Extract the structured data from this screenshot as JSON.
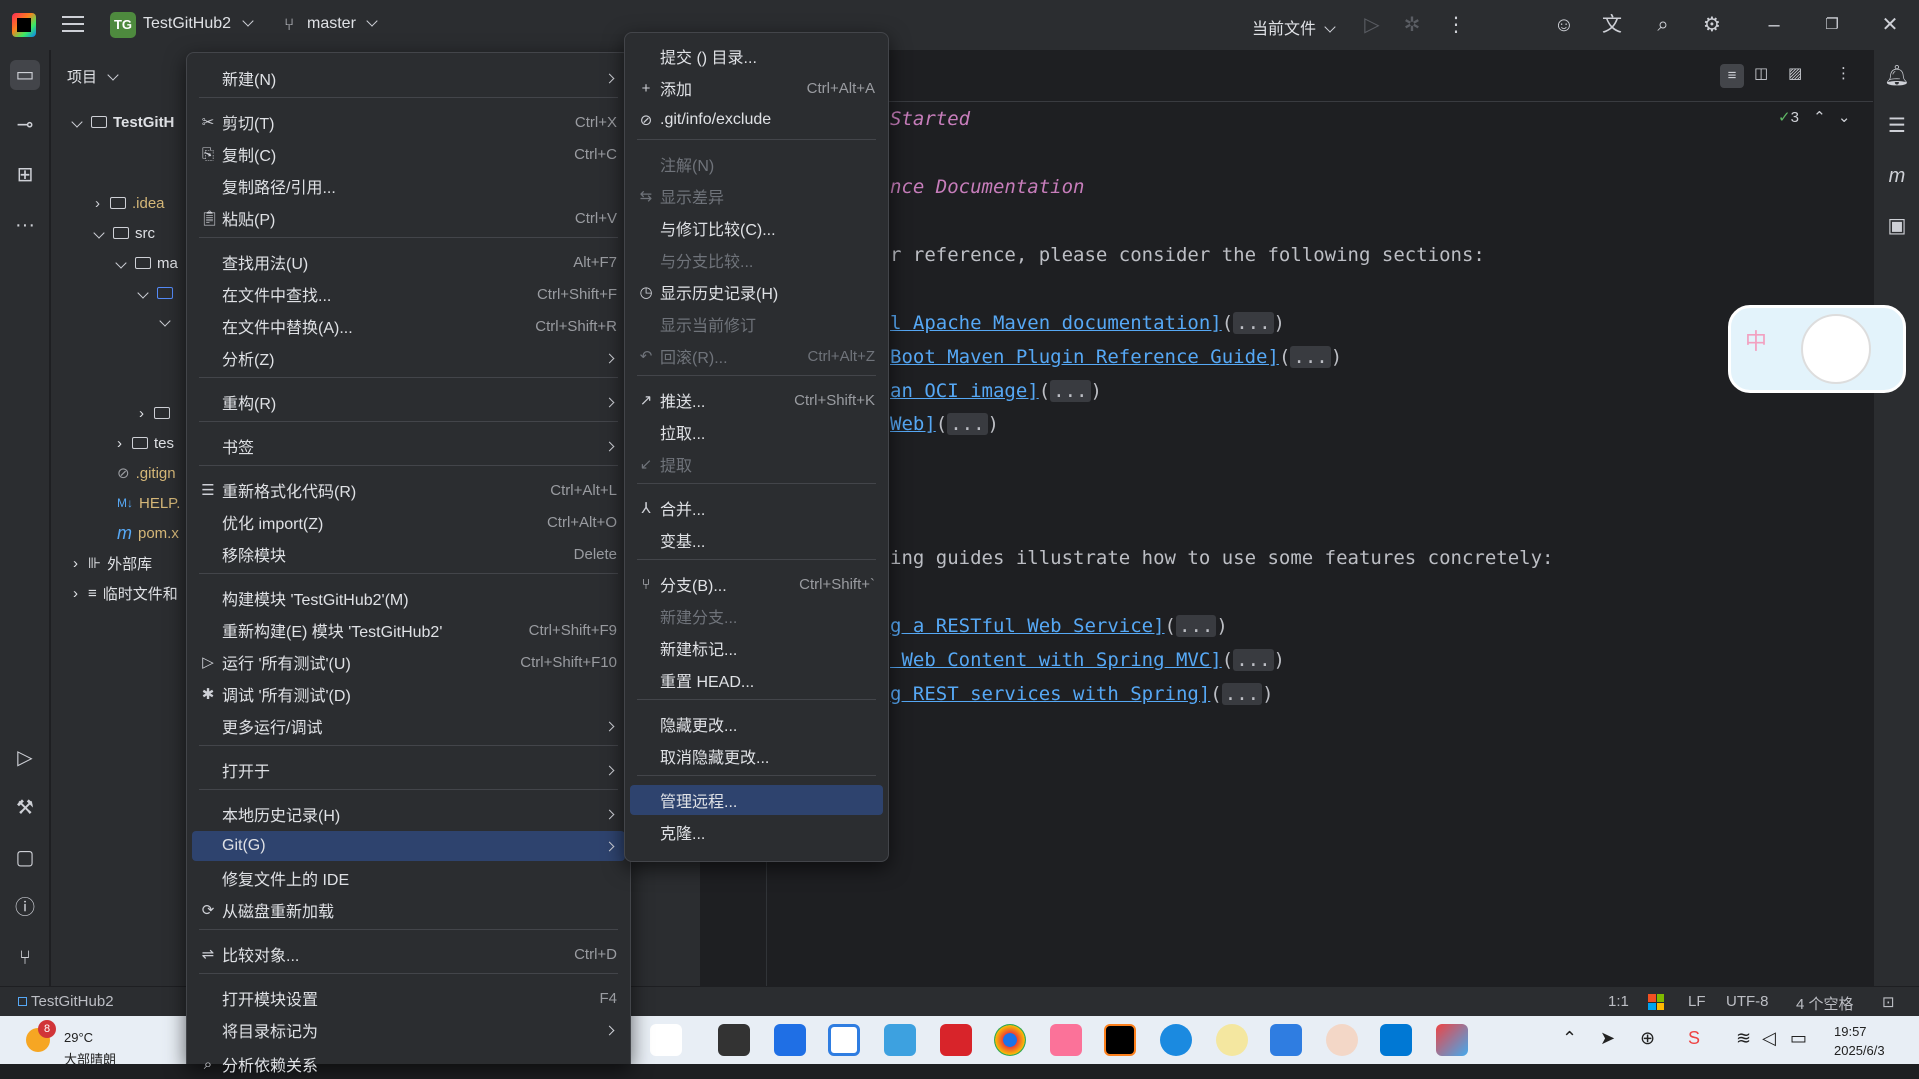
{
  "titlebar": {
    "project_badge": "TG",
    "project_name": "TestGitHub2",
    "branch": "master",
    "current_file": "当前文件"
  },
  "project_panel": {
    "title": "项目",
    "tree": [
      {
        "label": "TestGitH"
      },
      {
        "label": ".idea"
      },
      {
        "label": "src"
      },
      {
        "label": "ma"
      },
      {
        "label": "tes"
      },
      {
        "label": ".gitign"
      },
      {
        "label": "HELP."
      },
      {
        "label": "pom.x"
      },
      {
        "label": "外部库"
      },
      {
        "label": "临时文件和"
      }
    ]
  },
  "editor": {
    "inspection_count": "3",
    "lines": {
      "l1": "Started",
      "l2": "nce Documentation",
      "l3": "r reference, please consider the following sections:",
      "l4_link": "l Apache Maven documentation]",
      "l5_link": "Boot Maven Plugin Reference Guide]",
      "l6_link": "an OCI image]",
      "l7_link": "Web]",
      "l8": "ing guides illustrate how to use some features concretely:",
      "l9_link": "g a RESTful Web Service]",
      "l10_link": " Web Content with Spring MVC]",
      "l11_link": "g REST services with Spring]",
      "fold": "...",
      "paren_open": "(",
      "paren_close": ")"
    }
  },
  "context_menu": {
    "items": [
      {
        "label": "新建(N)",
        "shortcut": ""
      },
      {
        "label": "剪切(T)",
        "shortcut": "Ctrl+X"
      },
      {
        "label": "复制(C)",
        "shortcut": "Ctrl+C"
      },
      {
        "label": "复制路径/引用...",
        "shortcut": ""
      },
      {
        "label": "粘贴(P)",
        "shortcut": "Ctrl+V"
      },
      {
        "label": "查找用法(U)",
        "shortcut": "Alt+F7"
      },
      {
        "label": "在文件中查找...",
        "shortcut": "Ctrl+Shift+F"
      },
      {
        "label": "在文件中替换(A)...",
        "shortcut": "Ctrl+Shift+R"
      },
      {
        "label": "分析(Z)",
        "shortcut": ""
      },
      {
        "label": "重构(R)",
        "shortcut": ""
      },
      {
        "label": "书签",
        "shortcut": ""
      },
      {
        "label": "重新格式化代码(R)",
        "shortcut": "Ctrl+Alt+L"
      },
      {
        "label": "优化 import(Z)",
        "shortcut": "Ctrl+Alt+O"
      },
      {
        "label": "移除模块",
        "shortcut": "Delete"
      },
      {
        "label": "构建模块 'TestGitHub2'(M)",
        "shortcut": ""
      },
      {
        "label": "重新构建(E) 模块 'TestGitHub2'",
        "shortcut": "Ctrl+Shift+F9"
      },
      {
        "label": "运行 '所有测试'(U)",
        "shortcut": "Ctrl+Shift+F10"
      },
      {
        "label": "调试 '所有测试'(D)",
        "shortcut": ""
      },
      {
        "label": "更多运行/调试",
        "shortcut": ""
      },
      {
        "label": "打开于",
        "shortcut": ""
      },
      {
        "label": "本地历史记录(H)",
        "shortcut": ""
      },
      {
        "label": "Git(G)",
        "shortcut": ""
      },
      {
        "label": "修复文件上的 IDE",
        "shortcut": ""
      },
      {
        "label": "从磁盘重新加载",
        "shortcut": ""
      },
      {
        "label": "比较对象...",
        "shortcut": "Ctrl+D"
      },
      {
        "label": "打开模块设置",
        "shortcut": "F4"
      },
      {
        "label": "将目录标记为",
        "shortcut": ""
      },
      {
        "label": "分析依赖关系",
        "shortcut": ""
      }
    ]
  },
  "git_menu": {
    "items": [
      {
        "label": "提交 () 目录...",
        "shortcut": ""
      },
      {
        "label": "添加",
        "shortcut": "Ctrl+Alt+A"
      },
      {
        "label": ".git/info/exclude",
        "shortcut": ""
      },
      {
        "label": "注解(N)",
        "shortcut": ""
      },
      {
        "label": "显示差异",
        "shortcut": ""
      },
      {
        "label": "与修订比较(C)...",
        "shortcut": ""
      },
      {
        "label": "与分支比较...",
        "shortcut": ""
      },
      {
        "label": "显示历史记录(H)",
        "shortcut": ""
      },
      {
        "label": "显示当前修订",
        "shortcut": ""
      },
      {
        "label": "回滚(R)...",
        "shortcut": "Ctrl+Alt+Z"
      },
      {
        "label": "推送...",
        "shortcut": "Ctrl+Shift+K"
      },
      {
        "label": "拉取...",
        "shortcut": ""
      },
      {
        "label": "提取",
        "shortcut": ""
      },
      {
        "label": "合并...",
        "shortcut": ""
      },
      {
        "label": "变基...",
        "shortcut": ""
      },
      {
        "label": "分支(B)...",
        "shortcut": "Ctrl+Shift+`"
      },
      {
        "label": "新建分支...",
        "shortcut": ""
      },
      {
        "label": "新建标记...",
        "shortcut": ""
      },
      {
        "label": "重置 HEAD...",
        "shortcut": ""
      },
      {
        "label": "隐藏更改...",
        "shortcut": ""
      },
      {
        "label": "取消隐藏更改...",
        "shortcut": ""
      },
      {
        "label": "管理远程...",
        "shortcut": ""
      },
      {
        "label": "克隆...",
        "shortcut": ""
      }
    ]
  },
  "statusbar": {
    "project": "TestGitHub2",
    "position": "1:1",
    "line_sep": "LF",
    "encoding": "UTF-8",
    "indent": "4 个空格"
  },
  "taskbar": {
    "weather_badge": "8",
    "temp": "29°C",
    "weather": "大部晴朗",
    "time": "19:57",
    "date": "2025/6/3"
  },
  "colors": {
    "highlight": "#2e436e",
    "link": "#56a8f5",
    "keyword": "#c77dbb"
  }
}
